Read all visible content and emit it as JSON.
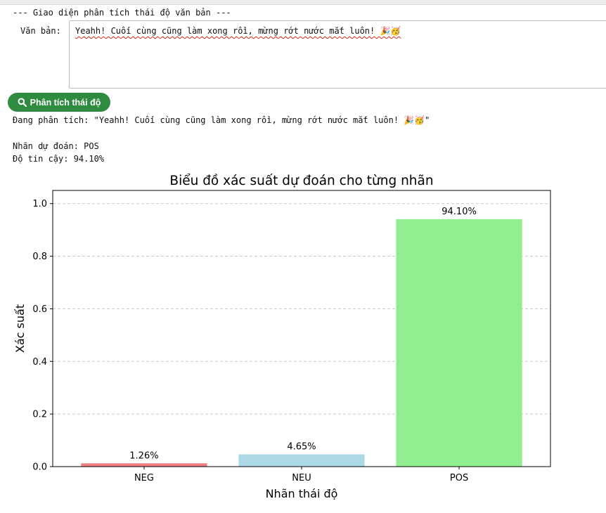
{
  "form": {
    "header": "--- Giao diện phân tích thái độ văn bản ---",
    "text_label": "Văn bản:",
    "text_value": "Yeahh! Cuối cùng cũng làm xong rồi, mừng rớt nước mắt luôn! 🎉🥳",
    "analyze_button": "Phân tích thái độ",
    "analyze_icon": "search-icon"
  },
  "output": {
    "analyzing": "Đang phân tích: \"Yeahh! Cuối cùng cũng làm xong rồi, mừng rớt nước mắt luôn! 🎉🥳\"",
    "prediction": "Nhãn dự đoán: POS",
    "confidence": "Độ tin cậy: 94.10%"
  },
  "chart_data": {
    "type": "bar",
    "title": "Biểu đồ xác suất dự đoán cho từng nhãn",
    "xlabel": "Nhãn thái độ",
    "ylabel": "Xác suất",
    "categories": [
      "NEG",
      "NEU",
      "POS"
    ],
    "values": [
      0.0126,
      0.0465,
      0.941
    ],
    "data_labels": [
      "1.26%",
      "4.65%",
      "94.10%"
    ],
    "colors": [
      "#f08080",
      "#add8e6",
      "#90ee90"
    ],
    "yticks": [
      "0.0",
      "0.2",
      "0.4",
      "0.6",
      "0.8",
      "1.0"
    ],
    "ylim": [
      0,
      1.05
    ],
    "grid": "y-dashed"
  }
}
